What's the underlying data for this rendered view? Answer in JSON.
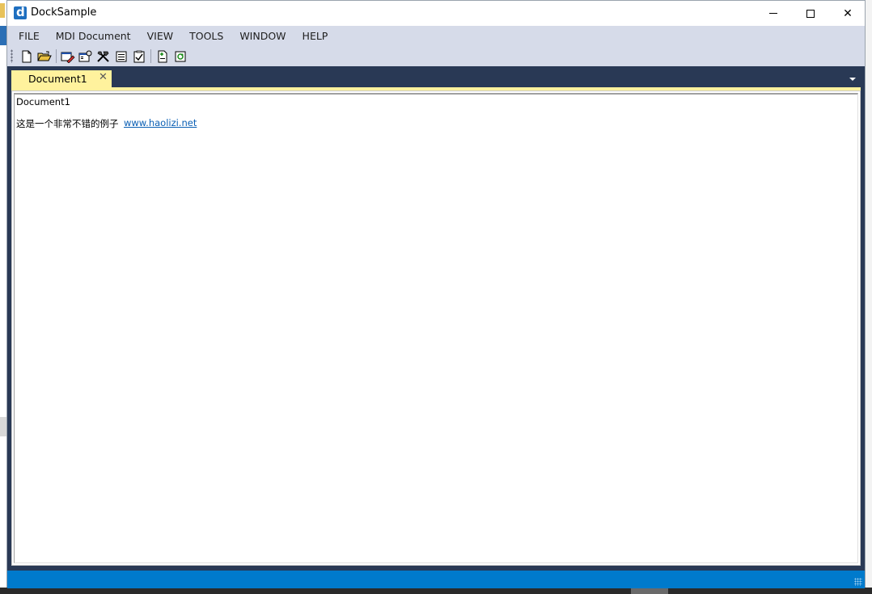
{
  "window": {
    "title": "DockSample",
    "minimize_label": "",
    "maximize_label": "",
    "close_label": "✕"
  },
  "menu": {
    "items": [
      "FILE",
      "MDI Document",
      "VIEW",
      "TOOLS",
      "WINDOW",
      "HELP"
    ]
  },
  "toolbar": {
    "buttons": [
      {
        "icon": "new-document-icon"
      },
      {
        "icon": "open-folder-icon"
      },
      {
        "icon": "edit-document-icon"
      },
      {
        "icon": "properties-icon"
      },
      {
        "icon": "tools-icon"
      },
      {
        "icon": "list-icon"
      },
      {
        "icon": "checklist-icon"
      },
      {
        "icon": "add-document-icon"
      },
      {
        "icon": "refresh-document-icon"
      }
    ]
  },
  "tabs": [
    {
      "label": "Document1",
      "close": "✕",
      "active": true
    }
  ],
  "document": {
    "title": "Document1",
    "text": "这是一个非常不错的例子",
    "link": "www.haolizi.net"
  },
  "colors": {
    "menubar": "#d6dbe9",
    "dock_background": "#293955",
    "active_tab": "#fff29d",
    "statusbar": "#007acc",
    "link": "#0a5fb4"
  }
}
